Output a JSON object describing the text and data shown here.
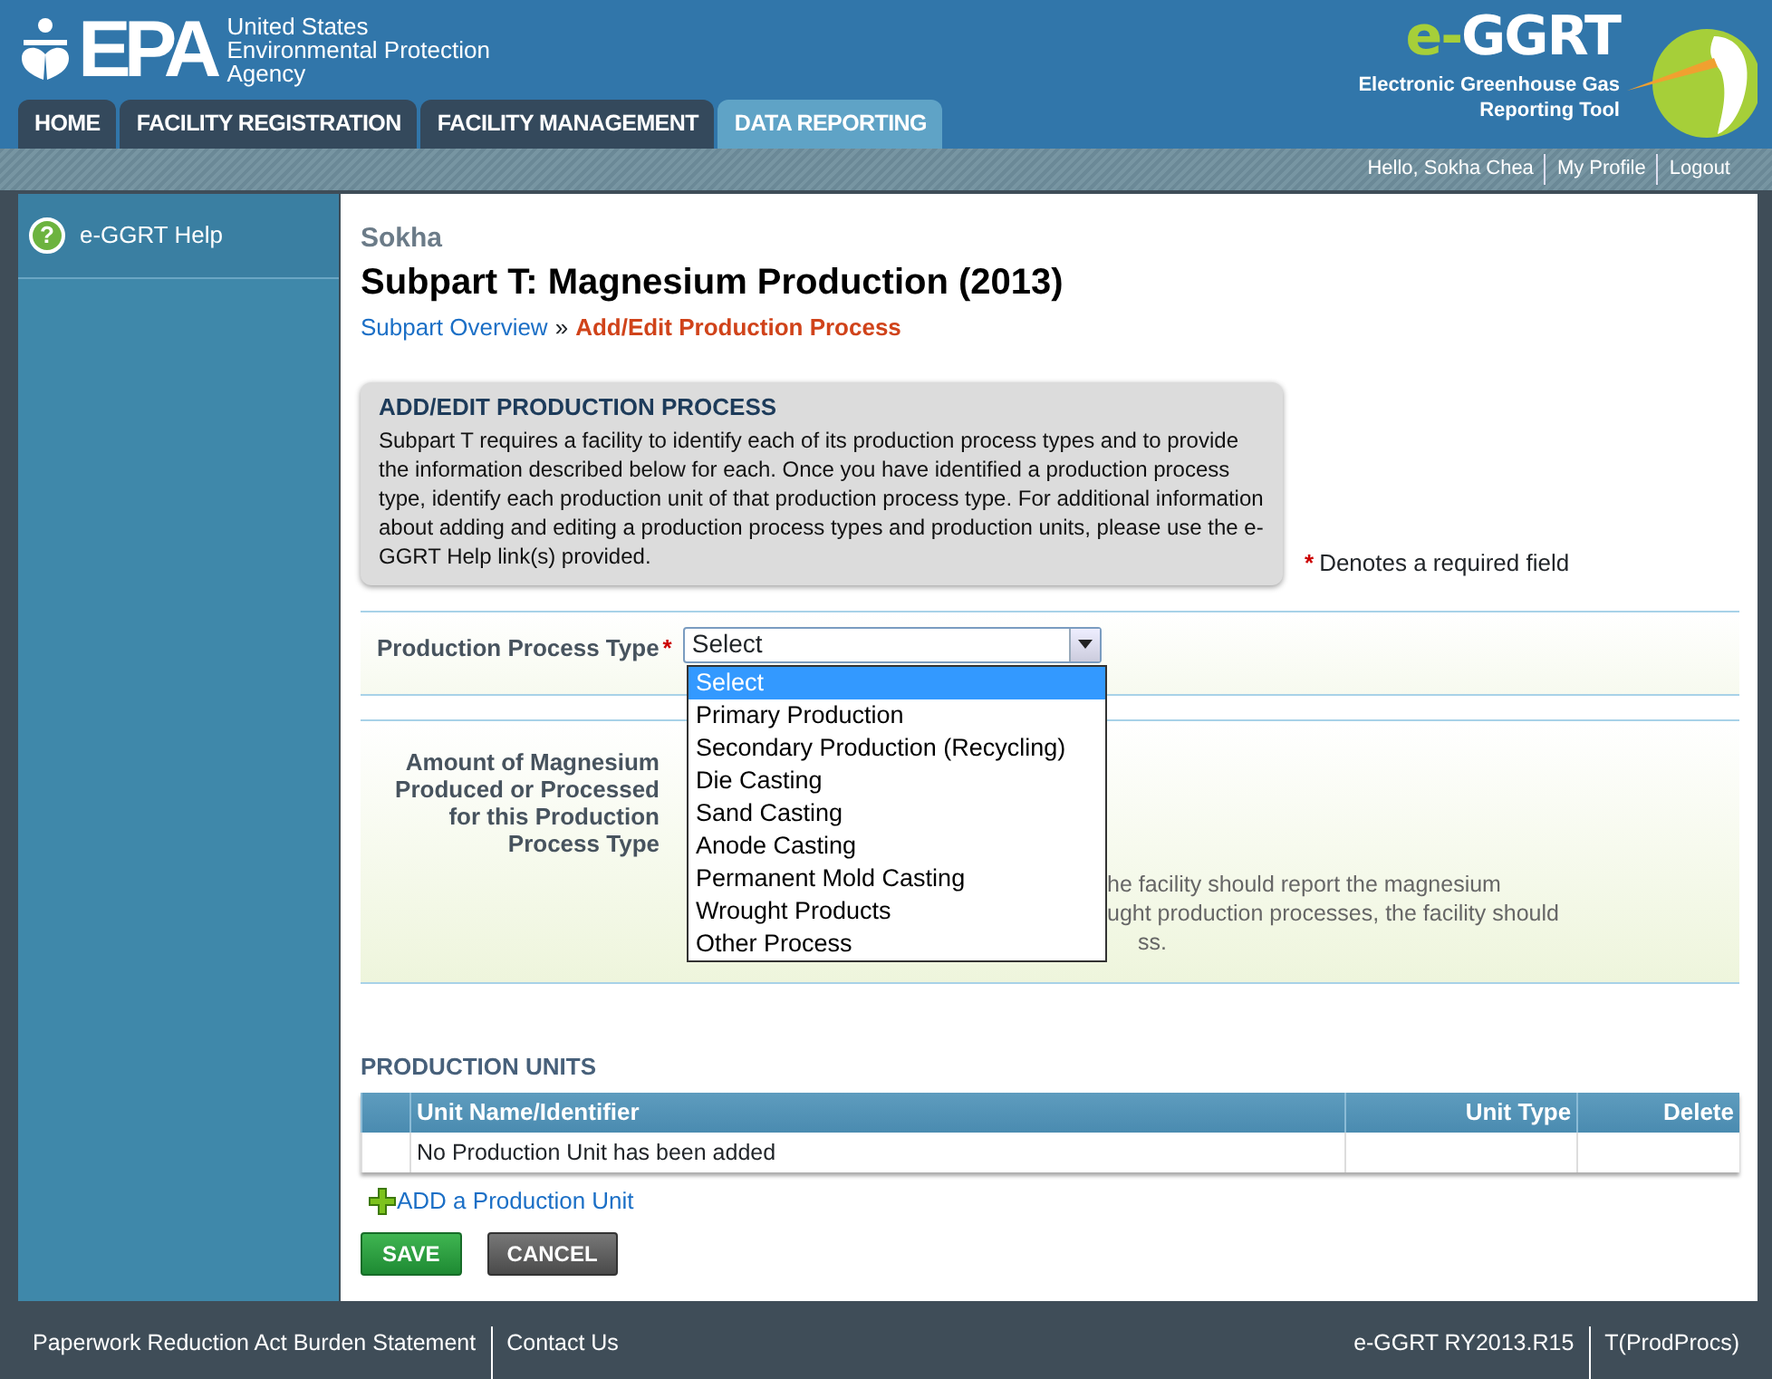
{
  "header": {
    "agency_logo": "EPA",
    "agency_name": [
      "United States",
      "Environmental Protection",
      "Agency"
    ],
    "app_logo_prefix": "e-",
    "app_logo_name": "GGRT",
    "app_subtitle": [
      "Electronic Greenhouse Gas",
      "Reporting Tool"
    ]
  },
  "tabs": [
    {
      "label": "HOME",
      "selected": false
    },
    {
      "label": "FACILITY REGISTRATION",
      "selected": false
    },
    {
      "label": "FACILITY MANAGEMENT",
      "selected": false
    },
    {
      "label": "DATA REPORTING",
      "selected": true
    }
  ],
  "user_links": [
    "Hello, Sokha Chea",
    "My Profile",
    "Logout"
  ],
  "sidebar": {
    "items": [
      {
        "icon": "?",
        "label": "e-GGRT Help"
      }
    ]
  },
  "page": {
    "facility": "Sokha",
    "title": "Subpart T: Magnesium Production (2013)",
    "breadcrumb": [
      {
        "label": "Subpart Overview",
        "current": false
      },
      {
        "label": "Add/Edit Production Process",
        "current": true
      }
    ],
    "breadcrumb_separator": "»"
  },
  "info_box": {
    "title": "ADD/EDIT PRODUCTION PROCESS",
    "text": "Subpart T requires a facility to identify each of its production process types and to provide the information described below for each. Once you have identified a production process type, identify each production unit of that production process type. For additional information about adding and editing a production process types and production units, please use the e-GGRT Help link(s) provided."
  },
  "required_note": {
    "mark": "*",
    "text": "Denotes a required field"
  },
  "form": {
    "process_type": {
      "label": "Production Process Type",
      "required": true,
      "value": "Select",
      "expanded": true,
      "options": [
        {
          "label": "Select",
          "selected": true
        },
        {
          "label": "Primary Production",
          "selected": false
        },
        {
          "label": "Secondary Production (Recycling)",
          "selected": false
        },
        {
          "label": "Die Casting",
          "selected": false
        },
        {
          "label": "Sand Casting",
          "selected": false
        },
        {
          "label": "Anode Casting",
          "selected": false
        },
        {
          "label": "Permanent Mold Casting",
          "selected": false
        },
        {
          "label": "Wrought Products",
          "selected": false
        },
        {
          "label": "Other Process",
          "selected": false
        }
      ]
    },
    "amount": {
      "label": "Amount of Magnesium Produced or Processed for this Production Process Type",
      "hint_lines": [
        "he facility should report the magnesium",
        "ught production processes, the facility should",
        "ss."
      ]
    }
  },
  "production_units": {
    "title": "PRODUCTION UNITS",
    "columns": [
      "Unit Name/Identifier",
      "Unit Type",
      "Delete"
    ],
    "empty_message": "No Production Unit has been added",
    "add_link": "ADD a Production Unit"
  },
  "buttons": [
    {
      "kind": "save",
      "label": "SAVE"
    },
    {
      "kind": "cancel",
      "label": "CANCEL"
    }
  ],
  "footer": {
    "left": [
      "Paperwork Reduction Act Burden Statement",
      "Contact Us"
    ],
    "right": [
      "e-GGRT RY2013.R15",
      "T(ProdProcs)"
    ]
  }
}
